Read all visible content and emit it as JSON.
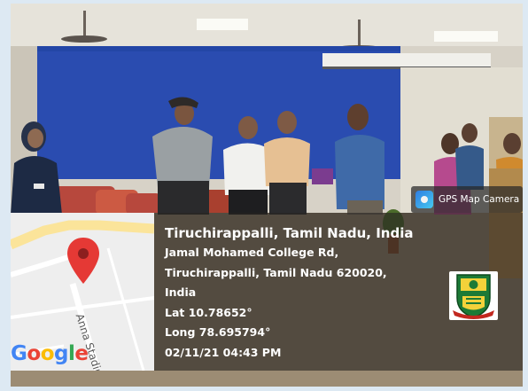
{
  "app": {
    "name": "GPS Map Camera"
  },
  "map": {
    "street_label": "Anna Stadium Rd",
    "logo_text": "Google",
    "logo_letters": [
      {
        "ch": "G",
        "color": "#4285F4"
      },
      {
        "ch": "o",
        "color": "#EA4335"
      },
      {
        "ch": "o",
        "color": "#FBBC05"
      },
      {
        "ch": "g",
        "color": "#4285F4"
      },
      {
        "ch": "l",
        "color": "#34A853"
      },
      {
        "ch": "e",
        "color": "#EA4335"
      }
    ],
    "pin_color": "#e53935"
  },
  "location": {
    "title": "Tiruchirappalli, Tamil Nadu, India",
    "address_lines": [
      "Jamal Mohamed College Rd,",
      "Tiruchirappalli, Tamil Nadu 620020,",
      "India"
    ],
    "latitude": "Lat 10.78652°",
    "longitude": "Long 78.695794°",
    "timestamp": "02/11/21 04:43 PM"
  },
  "colors": {
    "frame": "#dde9f3",
    "overlay": "#262420",
    "stage_backdrop": "#2a4cb0"
  }
}
